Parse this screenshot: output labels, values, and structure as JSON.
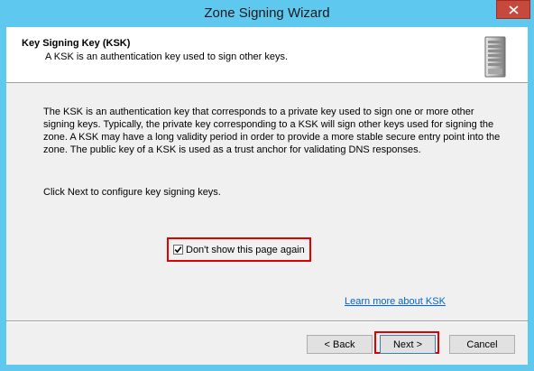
{
  "window": {
    "title": "Zone Signing Wizard",
    "close_glyph": "✕"
  },
  "header": {
    "title": "Key Signing Key (KSK)",
    "subtitle": "A KSK is an authentication key used to sign other keys.",
    "icon": "server-icon"
  },
  "body": {
    "paragraph": "The KSK is an authentication key that corresponds to a private key used to sign one or more other signing keys. Typically, the private key corresponding to a KSK will sign other keys used for signing the zone. A KSK may have a long validity period in order to provide a more stable secure entry point into the zone. The public key of a KSK is used as a trust anchor for validating DNS responses.",
    "instruction": "Click Next to configure key signing keys.",
    "checkbox_label": "Don't show this page again",
    "checkbox_checked": true,
    "learn_more": "Learn more about KSK"
  },
  "buttons": {
    "back": "< Back",
    "next": "Next >",
    "cancel": "Cancel"
  },
  "colors": {
    "accent_highlight": "#e00000",
    "link": "#0066cc",
    "chrome": "#5fc8ee",
    "close": "#c7483c"
  }
}
